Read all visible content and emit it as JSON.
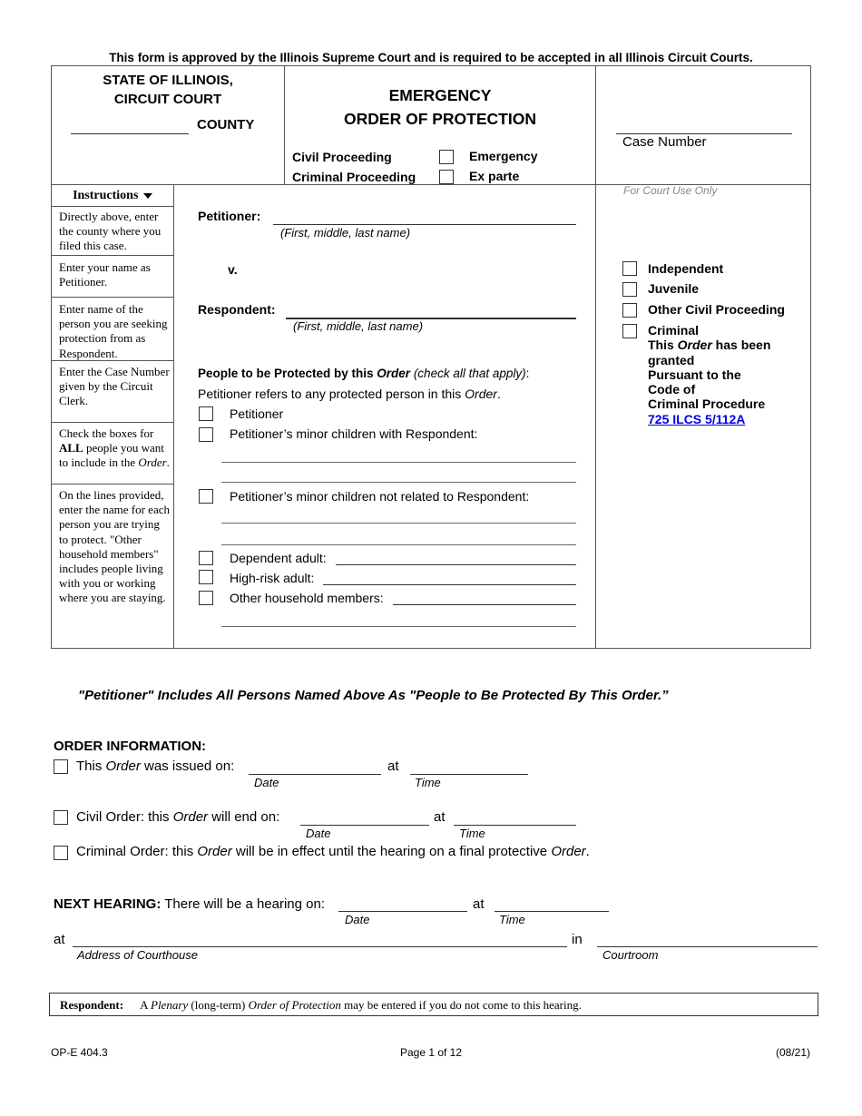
{
  "approval_notice": "This form is approved by the Illinois Supreme Court and is required to be accepted in all Illinois Circuit Courts.",
  "header": {
    "state_line1": "STATE OF ILLINOIS,",
    "state_line2": "CIRCUIT COURT",
    "county_label": "COUNTY",
    "county_value": "",
    "title_line1": "EMERGENCY",
    "title_line2": "ORDER OF PROTECTION",
    "civil_proceeding": "Civil Proceeding",
    "criminal_proceeding": "Criminal Proceeding",
    "emergency_label": "Emergency",
    "exparte_label": "Ex parte",
    "case_number_label": "Case Number",
    "case_number_value": ""
  },
  "instructions": {
    "heading": "Instructions",
    "items": [
      "Directly above, enter the county where you filed this case.",
      "Enter your name as Petitioner.",
      "Enter name of the person you are seeking protection from as Respondent.",
      "Enter the Case Number given by the Circuit Clerk.",
      "Check the boxes for ALL people you want to include in the Order.",
      "On the lines provided, enter the name for each person you are trying to protect. \"Other household members\" includes people living with you or working where you are staying."
    ],
    "item5_parts": {
      "a": "Check the boxes for ",
      "b": "ALL",
      "c": " people you want to include in the ",
      "d": "Order",
      "e": "."
    }
  },
  "parties": {
    "petitioner_label": "Petitioner:",
    "petitioner_value": "",
    "name_hint": "(First, middle, last name)",
    "versus": "v.",
    "respondent_label": "Respondent:",
    "respondent_value": ""
  },
  "protected": {
    "heading_a": "People to be Protected by this ",
    "heading_b": "Order",
    "heading_c": " (check all that apply)",
    "heading_d": ":",
    "note_a": "Petitioner refers to any protected person in this ",
    "note_b": "Order",
    "note_c": ".",
    "options": {
      "petitioner": "Petitioner",
      "minor_with": "Petitioner’s minor children with Respondent:",
      "minor_not": "Petitioner’s minor children not related to Respondent:",
      "dependent": "Dependent adult:",
      "high_risk": "High-risk adult:",
      "household": "Other household members:"
    }
  },
  "court_use": {
    "label": "For Court Use Only",
    "independent": "Independent",
    "juvenile": "Juvenile",
    "other_civil": "Other Civil Proceeding",
    "criminal": "Criminal",
    "criminal_note_a": "This ",
    "criminal_note_b": "Order",
    "criminal_note_c": " has been",
    "criminal_note_d": "granted",
    "criminal_note_e": "Pursuant to the",
    "criminal_note_f": "Code of",
    "criminal_note_g": "Criminal Procedure",
    "statute_link": "725 ILCS 5/112A"
  },
  "petitioner_statement": "\"Petitioner\" Includes All Persons Named Above As \"People to Be Protected By This Order.”",
  "order_info": {
    "heading": "ORDER INFORMATION:",
    "issued_a": "This ",
    "issued_b": "Order",
    "issued_c": " was issued on:",
    "civil_a": "Civil Order: this ",
    "civil_b": "Order",
    "civil_c": " will end on:",
    "criminal_a": "Criminal Order: this ",
    "criminal_b": "Order",
    "criminal_c": " will be in effect until the hearing on a final protective ",
    "criminal_d": "Order",
    "criminal_e": ".",
    "at": "at",
    "date_label": "Date",
    "time_label": "Time"
  },
  "next_hearing": {
    "label": "NEXT HEARING:",
    "text": " There will be a hearing on:",
    "at": "at",
    "in": "in",
    "date_label": "Date",
    "time_label": "Time",
    "address_label": "Address of Courthouse",
    "courtroom_label": "Courtroom"
  },
  "respondent_notice": {
    "label": "Respondent:",
    "a": "A ",
    "b": "Plenary",
    "c": " (long-term) ",
    "d": "Order of Protection",
    "e": " may be entered if you do not come to this hearing."
  },
  "footer": {
    "form_id": "OP-E 404.3",
    "page": "Page 1 of 12",
    "revision": "(08/21)"
  }
}
